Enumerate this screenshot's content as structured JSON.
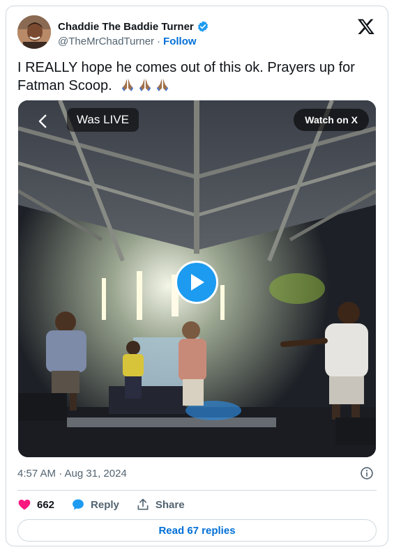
{
  "author": {
    "display_name": "Chaddie The Baddie Turner",
    "handle": "@TheMrChadTurner",
    "separator": "·",
    "follow_label": "Follow",
    "verified_color": "#1d9bf0",
    "avatar_icon": "avatar-photo"
  },
  "tweet": {
    "text": "I REALLY hope he comes out of this ok. Prayers up for Fatman Scoop.",
    "emoji": "🙏🏽🙏🏽🙏🏽"
  },
  "video": {
    "live_label": "Was LIVE",
    "watch_label": "Watch on X",
    "back_icon": "chevron-left-icon",
    "play_icon": "play-icon"
  },
  "meta": {
    "timestamp": "4:57 AM · Aug 31, 2024"
  },
  "actions": {
    "likes": "662",
    "reply_label": "Reply",
    "share_label": "Share",
    "like_color": "#f91880",
    "reply_color": "#1d9bf0"
  },
  "replies_button": {
    "label": "Read 67 replies"
  },
  "colors": {
    "link": "#006fd6",
    "muted": "#536471",
    "border": "#cfd9de"
  }
}
